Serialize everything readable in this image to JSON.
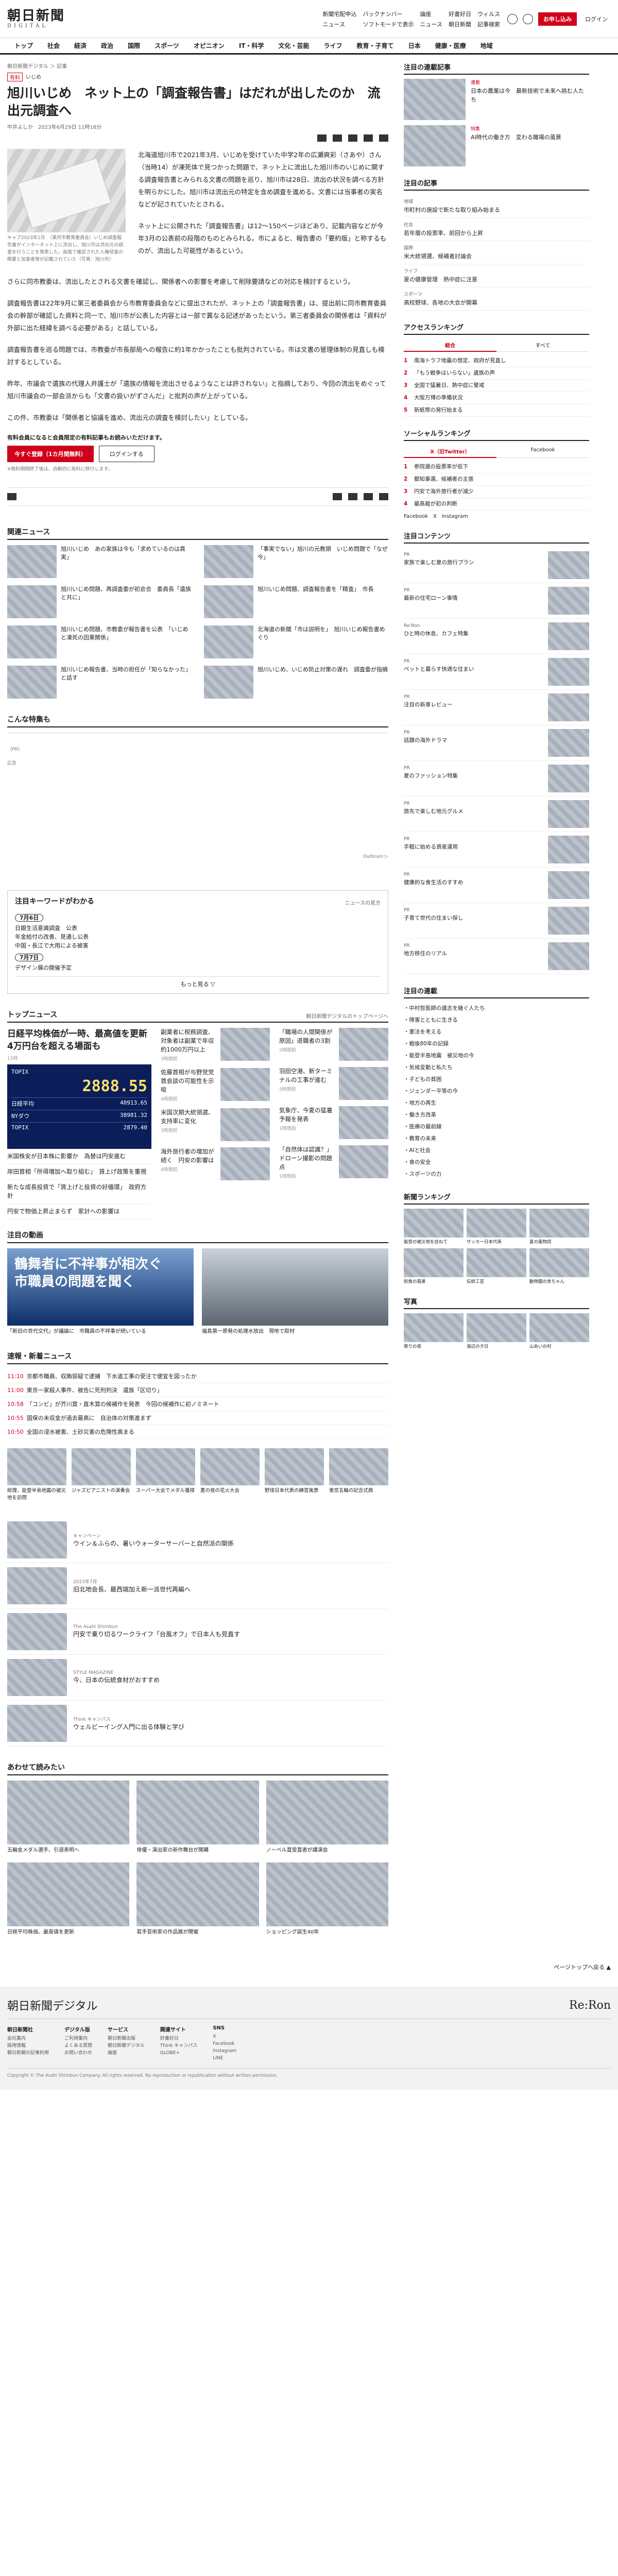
{
  "header": {
    "logo_ja": "朝日新聞",
    "logo_en": "DIGITAL",
    "links": [
      "新聞宅配申込",
      "バックナンバー",
      "論座",
      "好書好日",
      "ウィルス",
      "ニュース",
      "ソフトモードで表示",
      "ニュース",
      "朝日新聞",
      "記事検索"
    ],
    "search_label": "検索",
    "signup": "お申し込み",
    "login": "ログイン"
  },
  "gnav": [
    "トップ",
    "社会",
    "経済",
    "政治",
    "国際",
    "スポーツ",
    "オピニオン",
    "IT・科学",
    "文化・芸能",
    "ライフ",
    "教育・子育て",
    "日本",
    "健康・医療",
    "地域"
  ],
  "article": {
    "breadcrumb": "朝日新聞デジタル ＞ 記事",
    "tag": "有料",
    "tag2": "いじめ",
    "title": "旭川いじめ　ネット上の「調査報告書」はだれが出したのか　流出元調査へ",
    "author": "中井よしか",
    "date": "2023年6月29日 11時18分",
    "photo_caption": "キャプ2023年1月　（某所市教育委員会）いじめ調査報告書がインターネット上に流出し、旭川市は流出元の調査を行うことを発表した。画面で確認された人権侵害の概要と加害者等が記載されていた（写真：旭川市）",
    "paragraphs": [
      "北海道旭川市で2021年3月、いじめを受けていた中学2年の広瀬爽彩（さあや）さん（当時14）が凍死体で見つかった問題で、ネット上に流出した旭川市のいじめに関する調査報告書とみられる文書の問題を巡り、旭川市は28日、流出の状況を調べる方針を明らかにした。旭川市は流出元の特定を含め調査を進める。文書には当事者の実名などが記されていたとされる。",
      "ネット上に公開された「調査報告書」は12～150ページほどあり、記載内容などが今年3月の公表前の段階のものとみられる。市によると、報告書の「要約版」と称するものが、流出した可能性があるという。",
      "さらに同市教委は、流出したとされる文書を確認し、関係者への影響を考慮して削除要請などの対応を検討するという。",
      "調査報告書は22年9月に第三者委員会から市教育委員会などに提出されたが、ネット上の「調査報告書」は、提出前に同市教育委員会の幹部が確認した資料と同一で、旭川市が公表した内容とは一部で異なる記述があったという。第三者委員会の関係者は「資料が外部に出た経緯を調べる必要がある」と話している。",
      "調査報告書を巡る問題では、市教委が市長部局への報告に約1年かかったことも批判されている。市は文書の管理体制の見直しも検討するとしている。",
      "昨年、市議会で遺族の代理人弁護士が「遺族の情報を流出させるようなことは許されない」と指摘しており、今回の流出をめぐって旭川市議会の一部会派からも「文書の扱いがずさんだ」と批判の声が上がっている。",
      "この件、市教委は「関係者と協議を進め、流出元の調査を検討したい」としている。"
    ],
    "paywall_msg": "有料会員になると会員限定の有料記事もお読みいただけます。",
    "subscribe_btn": "今すぐ登録（1カ月間無料）",
    "login_btn": "ログインする",
    "paywall_note": "※無料期間終了後は、自動的に有料に移行します。"
  },
  "related": {
    "heading": "関連ニュース",
    "items": [
      "旭川いじめ　あの家族は今も「求めているのは真実」",
      "「事実でない」旭川の元教頭　いじめ問題で「なぜ今」",
      "旭川いじめ問題、再調査委が初会合　委員長「遺族と共に」",
      "旭川いじめ問題、調査報告書を「精査」　市長",
      "旭川いじめ問題、市教委が報告書を公表　「いじめと凍死の因果関係」",
      "北海道の新聞「市は説明を」　旭川いじめ報告書めぐり",
      "旭川いじめ報告書、当時の担任が「知らなかった」と話す",
      "旭川いじめ、いじめ防止対策の遅れ　調査委が指摘"
    ]
  },
  "special": {
    "heading": "こんな特集も",
    "caption": "（PR）",
    "ad_note": "広告"
  },
  "outbrain": "Outbrain ▷",
  "keywords": {
    "heading": "注目キーワードがわかる",
    "more": "ニュースの見方",
    "days": [
      {
        "label": "7月6日",
        "items": [
          "日銀生活意識調査　公表",
          "年金給付の改善、見通し公表",
          "中国・長江で大雨による被害"
        ]
      },
      {
        "label": "7月7日",
        "items": [
          "デザイン展の開催予定"
        ]
      }
    ],
    "more_btn": "もっと見る ▽"
  },
  "topnews": {
    "heading": "トップニュース",
    "more": "朝日新聞デジタルのトップページへ",
    "lead_title": "日経平均株価が一時、最高値を更新　4万円台を超える場面も",
    "lead_date": "15時",
    "stock_label": "TOPIX",
    "stock_value": "2888.55",
    "stock_rows": [
      [
        "日経平均",
        "40913.65"
      ],
      [
        "NYダウ",
        "38981.32"
      ],
      [
        "TOPIX",
        "2879.40"
      ]
    ],
    "list": [
      "米国株安が日本株に影響か　為替は円安進む",
      "岸田首相「所得増加へ取り組む」　賃上げ政策を重視",
      "新たな成長投資で「賃上げと投資の好循環」　政府方針",
      "円安で物価上昇止まらず　家計への影響は"
    ],
    "mid": [
      {
        "t": "副業者に税務調査、対象者は副業で年収約1000万円以上",
        "d": "3時間前"
      },
      {
        "t": "佐藤首相が与野党党首会談の可能性を示唆",
        "d": "4時間前"
      },
      {
        "t": "米国次期大統領選、支持率に変化",
        "d": "3時間前"
      },
      {
        "t": "海外旅行者の増加が続く　円安の影響は",
        "d": "4時間前"
      }
    ],
    "right": [
      {
        "t": "「職場の人間関係が原因」退職者の3割",
        "d": "2時間前"
      },
      {
        "t": "羽田空港、新ターミナルの工事が進む",
        "d": "5時間前"
      },
      {
        "t": "気象庁、今夏の猛暑予報を発表",
        "d": "1時間前"
      },
      {
        "t": "「自然体は認識？」ドローン撮影の問題点",
        "d": "1時間前"
      }
    ]
  },
  "attention": {
    "heading": "注目の動画",
    "banner1": "鶴舞者に不祥事が相次ぐ　市職員の問題を聞く",
    "cap1": "「新旧の世代交代」が議論に　市職員の不祥事が続いている",
    "cap2": "福島第一原発の処理水放出　現地で取材"
  },
  "flash": {
    "heading": "速報・新着ニュース",
    "items": [
      {
        "time": "11:10",
        "t": "京都市職員、収賄容疑で逮捕　下水道工事の受注で便宜を図ったか"
      },
      {
        "time": "11:00",
        "t": "東京一家殺人事件、被告に死刑判決　遺族「区切り」"
      },
      {
        "time": "10:58",
        "t": "「コンビ」が芥川賞・直木賞の候補作を発表　今回の候補作に初ノミネート"
      },
      {
        "time": "10:55",
        "t": "国保の未収金が過去最高に　自治体の対策進まず"
      },
      {
        "time": "10:50",
        "t": "全国の浸水被害、土砂災害の危険性高まる"
      }
    ]
  },
  "photos": [
    "総理、能登半島地震の被災地を訪問",
    "ジャズピアニストの演奏会",
    "スーパー大会でメダル獲得",
    "夏の夜の花火大会",
    "野球日本代表の練習風景",
    "東京五輪の記念式典"
  ],
  "promos": [
    {
      "s": "キャンペーン",
      "t": "ウイン＆ふらの、暑いウォーターサーバーと自然派の関係"
    },
    {
      "s": "2023年7月",
      "t": "旧北地会長、最西端加え新一派世代再編へ"
    },
    {
      "s": "The Asahi Shimbun",
      "t": "円安で乗り切るワークライフ「台風オフ」で日本人も見直す"
    },
    {
      "s": "STYLE MAGAZINE",
      "t": "今、日本の伝統食材がおすすめ"
    },
    {
      "s": "Think キャンパス",
      "t": "ウェルビーイング入門に出る体験と学び"
    }
  ],
  "recs": {
    "heading": "あわせて読みたい",
    "items": [
      "五輪金メダル選手、引退表明へ",
      "俳優・演出家の新作舞台が開幕",
      "ノーベル賞受賞者が講演会",
      "日経平均株価、最高値を更新",
      "若手芸術家の作品展が開催",
      "ショッピング誕生40年"
    ]
  },
  "sidebar": {
    "pickup_heading": "注目の連載記事",
    "pickup": [
      {
        "k": "連載",
        "t": "日本の農業は今　最新技術で未来へ挑む人たち"
      },
      {
        "k": "特集",
        "t": "AI時代の働き方　変わる職場の風景"
      }
    ],
    "list_heading": "注目の記事",
    "list": [
      {
        "k": "地域",
        "t": "市町村の施設で新たな取り組み始まる"
      },
      {
        "k": "社会",
        "t": "若年層の投票率、前回から上昇"
      },
      {
        "k": "国際",
        "t": "米大統領選、候補者討論会"
      },
      {
        "k": "ライフ",
        "t": "夏の健康管理　熱中症に注意"
      },
      {
        "k": "スポーツ",
        "t": "高校野球、各地の大会が開幕"
      }
    ],
    "access_heading": "アクセスランキング",
    "access_tabs": [
      "総合",
      "すべて"
    ],
    "access": [
      "南海トラフ地震の想定、政府が見直し",
      "「もう戦争はいらない」遺族の声",
      "全国で猛暑日、熱中症に警戒",
      "大阪万博の準備状況",
      "新紙幣の発行始まる"
    ],
    "social_heading": "ソーシャルランキング",
    "social_tabs": [
      "X（旧Twitter）",
      "Facebook"
    ],
    "social": [
      "参院選の投票率が低下",
      "都知事選、候補者の主張",
      "円安で海外旅行者が減少",
      "最高裁が初の判断"
    ],
    "social_links": [
      "Facebook",
      "X",
      "Instagram"
    ],
    "content_heading": "注目コンテンツ",
    "content": [
      {
        "k": "PR",
        "t": "家族で楽しむ夏の旅行プラン"
      },
      {
        "k": "PR",
        "t": "最新の住宅ローン事情"
      },
      {
        "k": "Re:Ron",
        "t": "ひと時の休息、カフェ特集"
      },
      {
        "k": "PR",
        "t": "ペットと暮らす快適な住まい"
      },
      {
        "k": "PR",
        "t": "注目の新車レビュー"
      },
      {
        "k": "PR",
        "t": "話題の海外ドラマ"
      },
      {
        "k": "PR",
        "t": "夏のファッション特集"
      },
      {
        "k": "PR",
        "t": "旅先で楽しむ地元グルメ"
      },
      {
        "k": "PR",
        "t": "手軽に始める資産運用"
      },
      {
        "k": "PR",
        "t": "健康的な食生活のすすめ"
      },
      {
        "k": "PR",
        "t": "子育て世代の住まい探し"
      },
      {
        "k": "PR",
        "t": "地方移住のリアル"
      }
    ],
    "serial_heading": "注目の連載",
    "serial": [
      "中村哲医師の遺志を継ぐ人たち",
      "障害とともに生きる",
      "憲法を考える",
      "戦後80年の記録",
      "能登半島地震　被災地の今",
      "気候変動と私たち",
      "子どもの貧困",
      "ジェンダー平等の今",
      "地方の再生",
      "働き方改革",
      "医療の最前線",
      "教育の未来",
      "AIと社会",
      "食の安全",
      "スポーツの力"
    ],
    "photo_heading": "新聞ランキング",
    "photos": [
      "能登の被災地を訪ねて",
      "サッカー日本代表",
      "夏の風物詩",
      "街角の風景",
      "伝統工芸",
      "動物園の赤ちゃん"
    ],
    "more_heading": "写真",
    "more_photos": [
      "祭りの夜",
      "海辺の夕日",
      "山あいの村"
    ]
  },
  "footer": {
    "pagetop": "ページトップへ戻る ▲",
    "logo": "朝日新聞デジタル",
    "re_ron": "Re:Ron",
    "cols": [
      {
        "h": "朝日新聞社",
        "items": [
          "会社案内",
          "採用情報",
          "朝日新聞の記事利用"
        ]
      },
      {
        "h": "デジタル版",
        "items": [
          "ご利用案内",
          "よくある質問",
          "お問い合わせ"
        ]
      },
      {
        "h": "サービス",
        "items": [
          "朝日新聞出版",
          "朝日新聞デジタル",
          "論座"
        ]
      },
      {
        "h": "関連サイト",
        "items": [
          "好書好日",
          "Think キャンパス",
          "GLOBE+"
        ]
      },
      {
        "h": "SNS",
        "items": [
          "X",
          "Facebook",
          "Instagram",
          "LINE"
        ]
      }
    ],
    "copyright": "Copyright © The Asahi Shimbun Company. All rights reserved. No reproduction or republication without written permission."
  }
}
